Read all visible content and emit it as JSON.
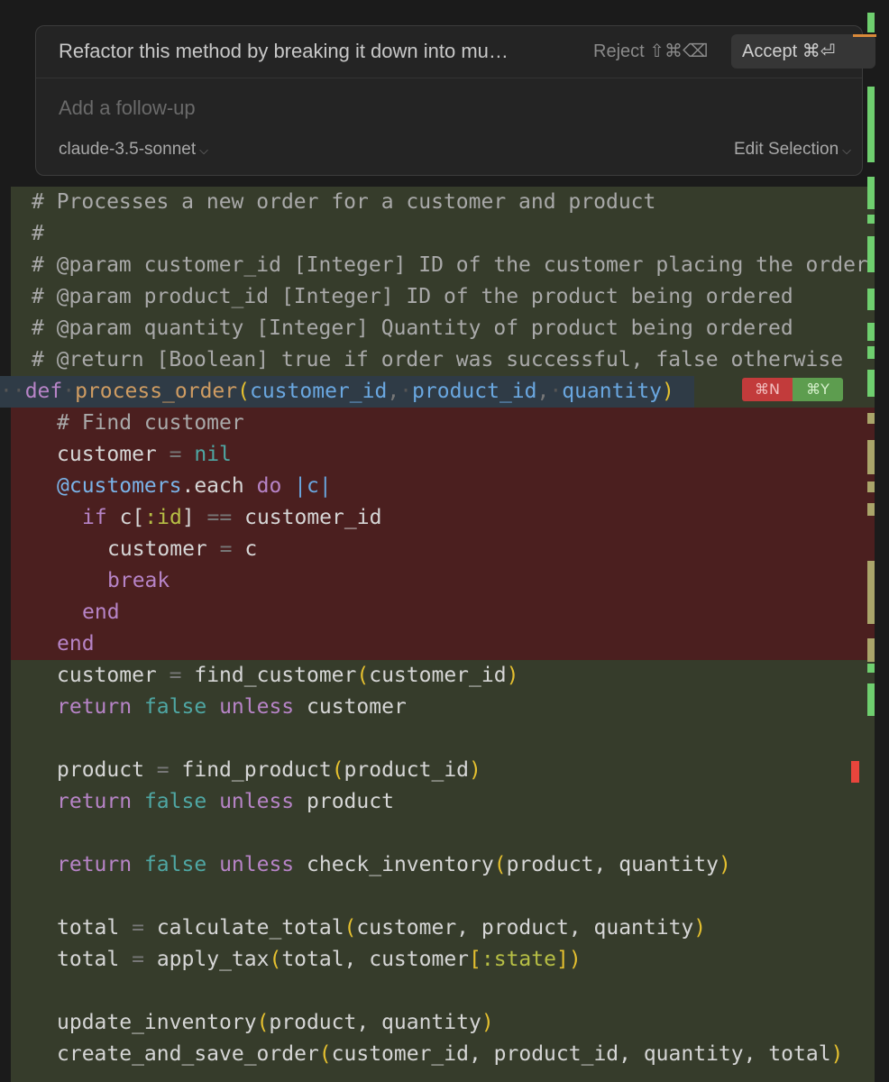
{
  "panel": {
    "prompt": "Refactor this method by breaking it down into mu…",
    "reject_label": "Reject ⇧⌘⌫",
    "accept_label": "Accept ⌘⏎",
    "followup_placeholder": "Add a follow-up",
    "model": "claude-3.5-sonnet",
    "mode": "Edit Selection"
  },
  "diff_badges": {
    "reject": "⌘N",
    "accept": "⌘Y"
  },
  "code": {
    "comment1": "# Processes a new order for a customer and product",
    "comment2": "#",
    "comment3": "# @param customer_id [Integer] ID of the customer placing the order",
    "comment4": "# @param product_id [Integer] ID of the product being ordered",
    "comment5": "# @param quantity [Integer] Quantity of product being ordered",
    "comment6": "# @return [Boolean] true if order was successful, false otherwise",
    "def_kw": "def",
    "def_name": "process_order",
    "def_params": [
      "customer_id",
      "product_id",
      "quantity"
    ],
    "removed": {
      "find_comment": "# Find customer",
      "assign_var": "customer",
      "nil": "nil",
      "ivar": "@customers",
      "each": ".each",
      "do": "do",
      "block_param": "|c|",
      "if": "if",
      "c": "c",
      "id_sym": ":id",
      "eq": "==",
      "customer_id": "customer_id",
      "assign2": "customer",
      "c2": "c",
      "break": "break",
      "end1": "end",
      "end2": "end"
    },
    "added": {
      "l1_var": "customer",
      "l1_fn": "find_customer",
      "l1_arg": "customer_id",
      "l2_return": "return",
      "l2_false": "false",
      "l2_unless": "unless",
      "l2_var": "customer",
      "l4_var": "product",
      "l4_fn": "find_product",
      "l4_arg": "product_id",
      "l5_var": "product",
      "l7_fn": "check_inventory",
      "l7_args": "product, quantity",
      "l9_var": "total",
      "l9_fn": "calculate_total",
      "l9_args": "customer, product, quantity",
      "l10_var": "total",
      "l10_fn": "apply_tax",
      "l10_args": "total, customer",
      "l10_sym": ":state",
      "l12_fn": "update_inventory",
      "l12_args": "product, quantity",
      "l13_fn": "create_and_save_order",
      "l13_args": "customer_id, product_id, quantity, total"
    }
  },
  "colors": {
    "added_bg": "#363c2b",
    "removed_bg": "#4b1f1f",
    "reject_badge": "#c23b3b",
    "accept_badge": "#5d9d4f"
  }
}
